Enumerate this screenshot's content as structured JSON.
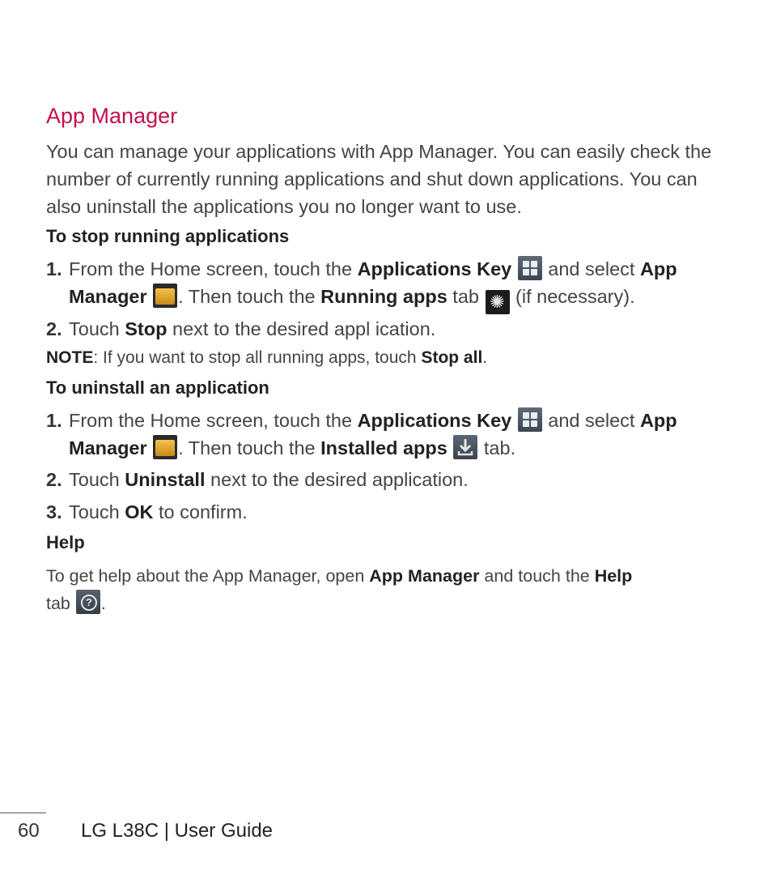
{
  "title": "App Manager",
  "intro": "You can manage your applications with App Manager. You can easily check the number of currently running applications and shut down applications. You can also uninstall the applications you no longer want to use.",
  "section_stop": {
    "heading": "To stop running applications",
    "step1": {
      "num": "1.",
      "t1": "From the Home screen, touch the ",
      "b1": "Applications Key",
      "t2": " and select ",
      "b2": "App Manager",
      "t3": ". Then touch the ",
      "b3": "Running apps",
      "t4": " tab ",
      "t5": " (if necessary)."
    },
    "step2": {
      "num": "2.",
      "t1": "Touch ",
      "b1": "Stop",
      "t2": " next to the desired appl ication."
    },
    "note": {
      "label": "NOTE",
      "t1": ": If you want to stop all running apps, touch ",
      "b1": "Stop all",
      "t2": "."
    }
  },
  "section_uninstall": {
    "heading": "To uninstall an application",
    "step1": {
      "num": "1.",
      "t1": "From the Home screen, touch the ",
      "b1": "Applications Key",
      "t2": " and select ",
      "b2": "App Manager",
      "t3": ". Then touch the ",
      "b3": "Installed apps",
      "t4": " tab."
    },
    "step2": {
      "num": "2.",
      "t1": "Touch ",
      "b1": "Uninstall",
      "t2": " next to the desired application."
    },
    "step3": {
      "num": "3.",
      "t1": "Touch ",
      "b1": "OK",
      "t2": " to confirm."
    }
  },
  "section_help": {
    "heading": "Help",
    "t1": "To get help about the App Manager, open ",
    "b1": "App Manager",
    "t2": " and touch the ",
    "b2": "Help",
    "t3": " tab ",
    "t4": "."
  },
  "icons": {
    "applications_key": "applications-grid-icon",
    "app_manager": "app-manager-folder-icon",
    "running_apps": "running-apps-icon",
    "installed_apps": "installed-apps-download-icon",
    "help": "help-question-icon"
  },
  "footer": {
    "page_number": "60",
    "text": "LG L38C  |  User Guide"
  },
  "colors": {
    "title": "#c0104f"
  }
}
